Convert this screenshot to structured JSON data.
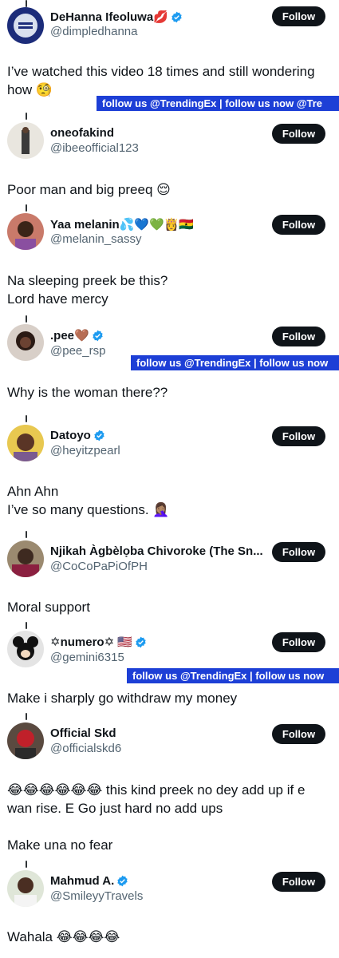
{
  "tweets": [
    {
      "name": "DeHanna Ifeoluwa💋",
      "handle": "@dimpledhanna",
      "verified": true,
      "text": "I’ve watched this video 18 times and still wondering\nhow 🧐"
    },
    {
      "name": "oneofakind",
      "handle": "@ibeeofficial123",
      "verified": false,
      "text": "Poor man and big preeq 😌"
    },
    {
      "name": "Yaa melanin💦💙💚👸🇬🇭",
      "handle": "@melanin_sassy",
      "verified": false,
      "text": "Na sleeping preek be this?\nLord have mercy"
    },
    {
      "name": ".pee🤎",
      "handle": "@pee_rsp",
      "verified": true,
      "text": "Why is the woman there??"
    },
    {
      "name": "Datoyo",
      "handle": "@heyitzpearl",
      "verified": true,
      "text": "Ahn Ahn\nI’ve so many questions. 🤦🏽‍♀️"
    },
    {
      "name": "Njikah Àgbèlọba Chivoroke (The Sn...",
      "handle": "@CoCoPaPiOfPH",
      "verified": false,
      "text": "Moral support"
    },
    {
      "name": "✡numero✡ 🇺🇸",
      "handle": "@gemini6315",
      "verified": true,
      "text": "Make i sharply go withdraw my money"
    },
    {
      "name": "Official Skd",
      "handle": "@officialskd6",
      "verified": false,
      "text": "😂😂😂😂😂😂 this kind preek no dey add up if e\nwan rise. E Go just hard no add ups\n\nMake una no fear"
    },
    {
      "name": "Mahmud A.",
      "handle": "@SmileyyTravels",
      "verified": true,
      "text": "Wahala 😂😂😂😂"
    }
  ],
  "follow_label": "Follow",
  "banners": [
    {
      "text": "follow us @TrendingEx | follow us now @Tre"
    },
    {
      "text": "follow us @TrendingEx | follow us now"
    },
    {
      "text": "follow us @TrendingEx | follow us now"
    }
  ],
  "colors": {
    "accent": "#1d9bf0",
    "banner": "#1d3fd6",
    "button": "#0f1419",
    "secondary_text": "#536471"
  }
}
